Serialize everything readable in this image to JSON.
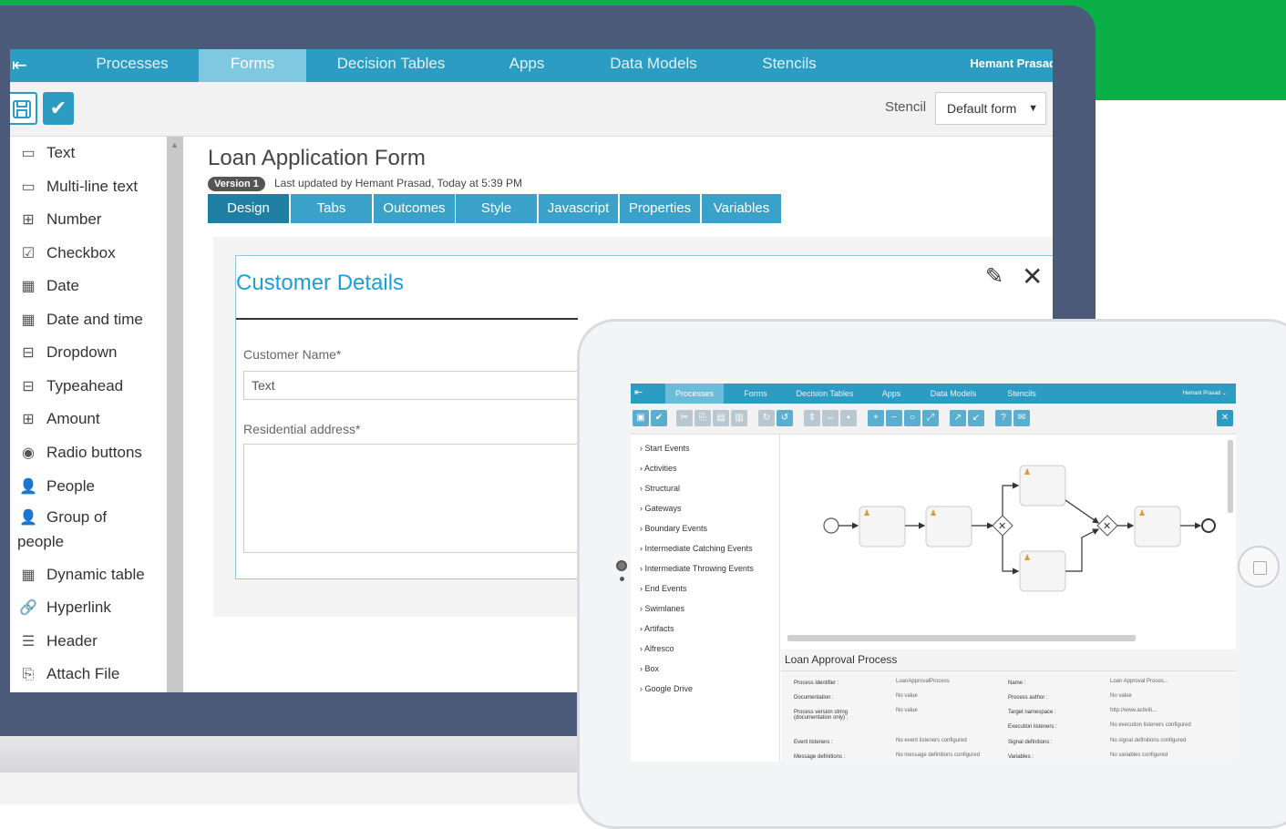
{
  "app": {
    "nav_tabs": [
      {
        "label": "Processes"
      },
      {
        "label": "Forms"
      },
      {
        "label": "Decision Tables"
      },
      {
        "label": "Apps"
      },
      {
        "label": "Data Models"
      },
      {
        "label": "Stencils"
      }
    ],
    "user": "Hemant Prasad"
  },
  "toolbar": {
    "stencil_label": "Stencil",
    "stencil_value": "Default form"
  },
  "palette": {
    "items": [
      {
        "label": "Text",
        "icon": "text-field-icon"
      },
      {
        "label": "Multi-line text",
        "icon": "multiline-text-icon"
      },
      {
        "label": "Number",
        "icon": "number-icon"
      },
      {
        "label": "Checkbox",
        "icon": "checkbox-icon"
      },
      {
        "label": "Date",
        "icon": "calendar-icon"
      },
      {
        "label": "Date and time",
        "icon": "calendar-icon"
      },
      {
        "label": "Dropdown",
        "icon": "dropdown-icon"
      },
      {
        "label": "Typeahead",
        "icon": "typeahead-icon"
      },
      {
        "label": "Amount",
        "icon": "amount-icon"
      },
      {
        "label": "Radio buttons",
        "icon": "radio-icon"
      },
      {
        "label": "People",
        "icon": "person-add-icon"
      },
      {
        "label": "Group of people",
        "icon": "person-add-icon"
      },
      {
        "label": "Dynamic table",
        "icon": "table-icon"
      },
      {
        "label": "Hyperlink",
        "icon": "link-icon"
      },
      {
        "label": "Header",
        "icon": "header-icon"
      },
      {
        "label": "Attach File",
        "icon": "attach-file-icon"
      }
    ]
  },
  "form": {
    "title": "Loan Application Form",
    "version": "Version 1",
    "updated": "Last updated by Hemant Prasad, Today at 5:39 PM",
    "tabs": [
      {
        "label": "Design"
      },
      {
        "label": "Tabs"
      },
      {
        "label": "Outcomes"
      },
      {
        "label": "Style"
      },
      {
        "label": "Javascript"
      },
      {
        "label": "Properties"
      },
      {
        "label": "Variables"
      }
    ],
    "section_title": "Customer Details",
    "fields": [
      {
        "label": "Customer Name*",
        "value": "Text"
      },
      {
        "label": "Residential address*",
        "value": ""
      }
    ]
  },
  "tablet": {
    "nav_tabs": [
      {
        "label": "Processes"
      },
      {
        "label": "Forms"
      },
      {
        "label": "Decision Tables"
      },
      {
        "label": "Apps"
      },
      {
        "label": "Data Models"
      },
      {
        "label": "Stencils"
      }
    ],
    "user": "Hemant Prasad ⌄",
    "palette": [
      "› Start Events",
      "› Activities",
      "› Structural",
      "› Gateways",
      "› Boundary Events",
      "› Intermediate Catching Events",
      "› Intermediate Throwing Events",
      "› End Events",
      "› Swimlanes",
      "› Artifacts",
      "› Alfresco",
      "› Box",
      "› Google Drive"
    ],
    "process_title": "Loan Approval Process",
    "properties": {
      "left": [
        {
          "label": "Process identifier :",
          "value": "LoanApprovalProcess"
        },
        {
          "label": "Documentation :",
          "value": "No value"
        },
        {
          "label": "Process version string (documentation only) :",
          "value": "No value"
        },
        {
          "label": "Event listeners :",
          "value": "No event listeners configured"
        },
        {
          "label": "Message definitions :",
          "value": "No message definitions configured"
        }
      ],
      "right": [
        {
          "label": "Name :",
          "value": "Loan Approval Proces..."
        },
        {
          "label": "Process author :",
          "value": "No value"
        },
        {
          "label": "Target namespace :",
          "value": "http://www.activiti..."
        },
        {
          "label": "Execution listeners :",
          "value": "No execution listeners configured"
        },
        {
          "label": "Signal definitions :",
          "value": "No signal definitions configured"
        },
        {
          "label": "Variables :",
          "value": "No variables configured"
        }
      ]
    }
  },
  "colors": {
    "brand_green": "#0aaf47",
    "nav_blue": "#2d9cc3",
    "accent_blue": "#1aa0d5",
    "laptop_frame": "#4a5a78"
  }
}
